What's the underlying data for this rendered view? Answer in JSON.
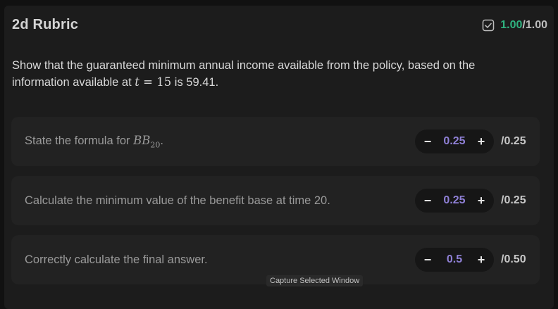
{
  "rubric": {
    "title": "2d Rubric",
    "score_earned": "1.00",
    "score_sep": "/",
    "score_total": "1.00",
    "check_icon": "check-square-icon",
    "accent_color": "#2fb380"
  },
  "prompt": {
    "before": "Show that the guaranteed minimum annual income available from the policy, based on the information available at ",
    "math_var": "t",
    "math_eq": " = 15",
    "after": " is 59.41."
  },
  "criteria": [
    {
      "text_before": "State the formula for ",
      "math": "BB",
      "math_sub": "20",
      "text_after": ".",
      "value": "0.25",
      "max": "/0.25",
      "minus": "−",
      "plus": "+"
    },
    {
      "text": "Calculate the minimum value of the benefit base at time 20.",
      "value": "0.25",
      "max": "/0.25",
      "minus": "−",
      "plus": "+"
    },
    {
      "text": "Correctly calculate the final answer.",
      "value": "0.5",
      "max": "/0.50",
      "minus": "−",
      "plus": "+"
    }
  ],
  "tooltip": "Capture Selected Window"
}
